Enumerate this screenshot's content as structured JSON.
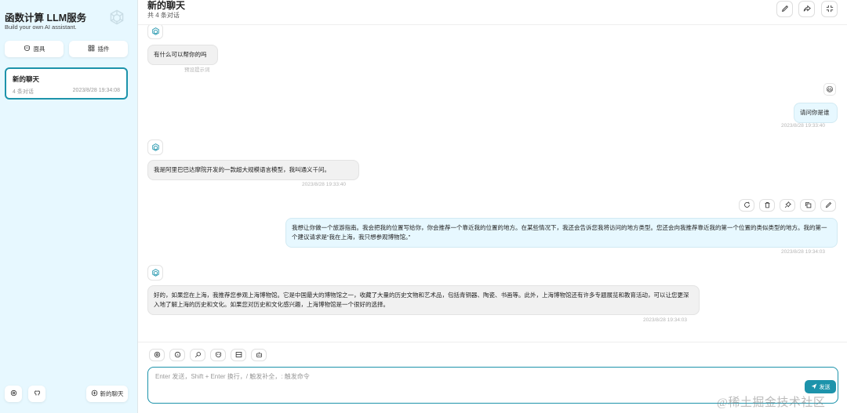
{
  "sidebar": {
    "title": "函数计算 LLM服务",
    "subtitle": "Build your own AI assistant.",
    "buttons": {
      "masks": "面具",
      "plugins": "插件"
    },
    "chats": [
      {
        "title": "新的聊天",
        "count": "4 条对话",
        "date": "2023/8/28 19:34:08"
      }
    ],
    "new_chat": "新的聊天"
  },
  "header": {
    "title": "新的聊天",
    "subtitle": "共 4 条对话"
  },
  "messages": [
    {
      "role": "bot",
      "text": "有什么可以帮你的吗",
      "meta": "预设提示词"
    },
    {
      "role": "user",
      "text": "请问你是谁",
      "meta": "2023/8/28 19:33:40"
    },
    {
      "role": "bot",
      "text": "我是阿里巴巴达摩院开发的一款超大规模语言模型，我叫通义千问。",
      "meta": "2023/8/28 19:33:40"
    },
    {
      "role": "user",
      "text": "我想让你做一个旅游指南。我会把我的位置写给你，你会推荐一个靠近我的位置的地方。在某些情况下，我还会告诉您我将访问的地方类型。您还会向我推荐靠近我的第一个位置的类似类型的地方。我的第一个建议请求是“我在上海，我只想参观博物馆。”",
      "meta": "2023/8/28 19:34:03"
    },
    {
      "role": "bot",
      "text": "好的，如果您在上海，我推荐您参观上海博物馆。它是中国最大的博物馆之一，收藏了大量的历史文物和艺术品，包括青铜器、陶瓷、书画等。此外，上海博物馆还有许多专题展览和教育活动，可以让您更深入地了解上海的历史和文化。如果您对历史和文化感兴趣，上海博物馆是一个很好的选择。",
      "meta": "2023/8/28 19:34:03"
    }
  ],
  "composer": {
    "placeholder": "Enter 发送，Shift + Enter 换行，/ 触发补全，: 触发命令",
    "send": "发送"
  },
  "watermark": "@稀土掘金技术社区",
  "colors": {
    "accent": "#1d93ab",
    "sidebar_bg": "#e7f8ff",
    "bot_bubble": "#f1f1f1",
    "user_bubble": "#e7f8ff"
  }
}
